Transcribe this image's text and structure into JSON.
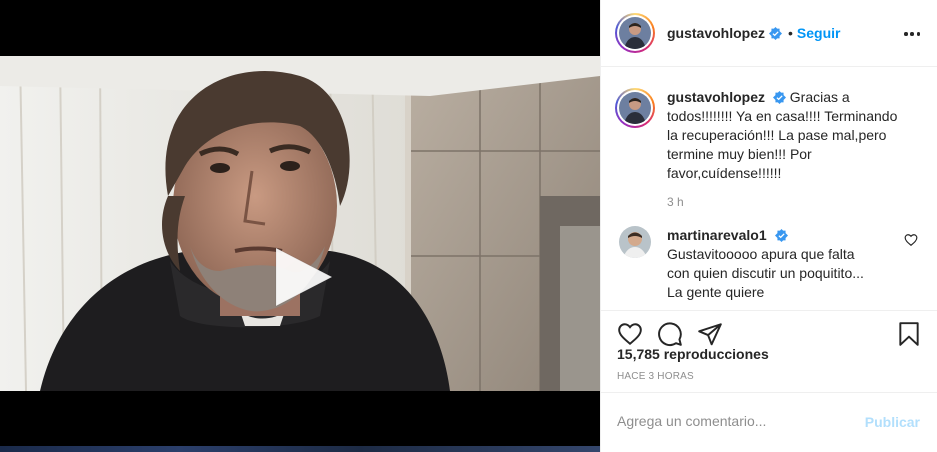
{
  "post": {
    "username": "gustavohlopez",
    "dot": "•",
    "follow_label": "Seguir",
    "caption": "Gracias a todos!!!!!!!! Ya en casa!!!! Terminando la recuperación!!! La pase mal,pero termine muy bien!!! Por favor,cuídense!!!!!!",
    "caption_time": "3 h",
    "views": "15,785 reproducciones",
    "posted_ago": "HACE 3 HORAS"
  },
  "comments": [
    {
      "username": "martinarevalo1",
      "text": "Gustavitooooo apura que falta con quien discutir un poquitito... La gente quiere"
    }
  ],
  "composer": {
    "placeholder": "Agrega un comentario...",
    "publish_label": "Publicar"
  },
  "icons": {
    "verified": "verified-badge-icon",
    "more": "more-options-icon",
    "like": "heart-icon",
    "comment": "comment-icon",
    "share": "send-icon",
    "save": "bookmark-icon",
    "play": "play-icon"
  },
  "colors": {
    "link_blue": "#0095f6",
    "publish_disabled": "#b2dffc",
    "muted": "#8e8e8e",
    "text": "#262626"
  }
}
